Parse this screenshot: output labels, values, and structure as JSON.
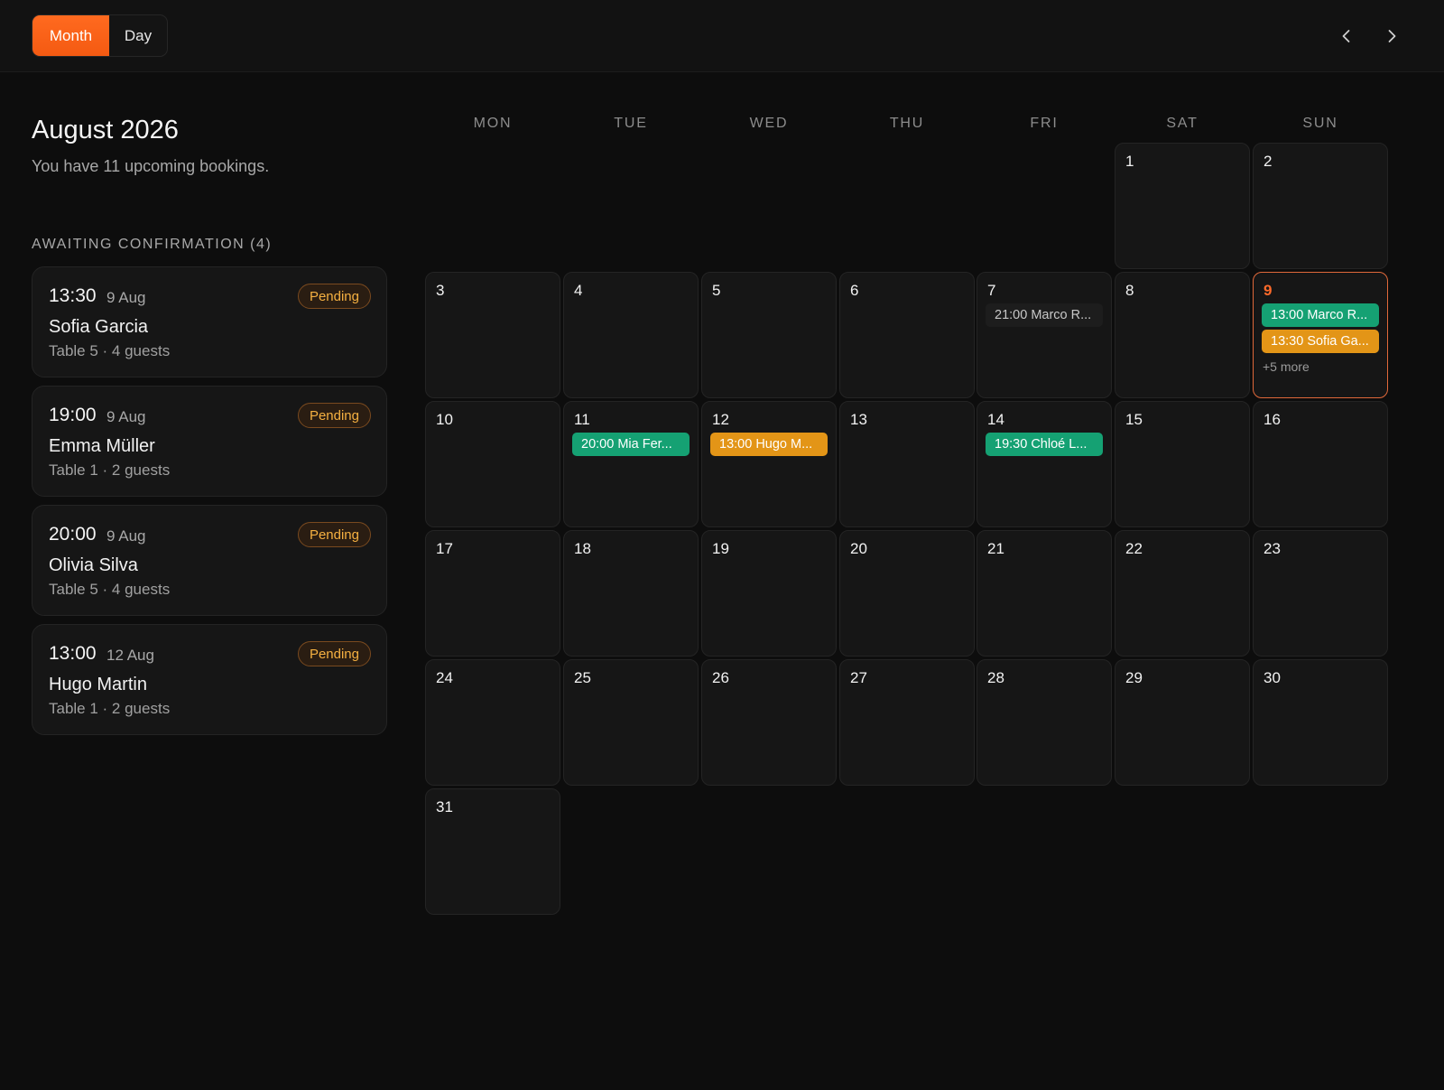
{
  "toolbar": {
    "views": [
      {
        "label": "Month",
        "active": true
      },
      {
        "label": "Day",
        "active": false
      }
    ],
    "prev_icon": "chevron-left-icon",
    "next_icon": "chevron-right-icon"
  },
  "colors": {
    "accent": "#ff6a1f",
    "confirmed": "#15a173",
    "pending": "#e39517",
    "background": "#0d0d0d",
    "card": "#161616"
  },
  "sidebar": {
    "title": "August 2026",
    "subtitle": "You have 11 upcoming bookings.",
    "section_label": "AWAITING CONFIRMATION (4)",
    "bookings": [
      {
        "time": "13:30",
        "date": "9 Aug",
        "name": "Sofia Garcia",
        "meta": "Table 5 · 4 guests",
        "status": "Pending"
      },
      {
        "time": "19:00",
        "date": "9 Aug",
        "name": "Emma Müller",
        "meta": "Table 1 · 2 guests",
        "status": "Pending"
      },
      {
        "time": "20:00",
        "date": "9 Aug",
        "name": "Olivia Silva",
        "meta": "Table 5 · 4 guests",
        "status": "Pending"
      },
      {
        "time": "13:00",
        "date": "12 Aug",
        "name": "Hugo Martin",
        "meta": "Table 1 · 2 guests",
        "status": "Pending"
      }
    ]
  },
  "calendar": {
    "weekdays": [
      "MON",
      "TUE",
      "WED",
      "THU",
      "FRI",
      "SAT",
      "SUN"
    ],
    "today": 9,
    "days": [
      {
        "day": "1",
        "events": []
      },
      {
        "day": "2",
        "events": []
      },
      {
        "day": "3",
        "events": []
      },
      {
        "day": "4",
        "events": []
      },
      {
        "day": "5",
        "events": []
      },
      {
        "day": "6",
        "events": []
      },
      {
        "day": "7",
        "events": [
          {
            "label": "21:00 Marco R...",
            "style": "grey"
          }
        ]
      },
      {
        "day": "8",
        "events": []
      },
      {
        "day": "9",
        "events": [
          {
            "label": "13:00 Marco R...",
            "style": "green"
          },
          {
            "label": "13:30 Sofia Ga...",
            "style": "orange"
          }
        ],
        "more": "+5 more"
      },
      {
        "day": "10",
        "events": []
      },
      {
        "day": "11",
        "events": [
          {
            "label": "20:00 Mia Fer...",
            "style": "green"
          }
        ]
      },
      {
        "day": "12",
        "events": [
          {
            "label": "13:00 Hugo M...",
            "style": "orange"
          }
        ]
      },
      {
        "day": "13",
        "events": []
      },
      {
        "day": "14",
        "events": [
          {
            "label": "19:30 Chloé L...",
            "style": "green"
          }
        ]
      },
      {
        "day": "15",
        "events": []
      },
      {
        "day": "16",
        "events": []
      },
      {
        "day": "17",
        "events": []
      },
      {
        "day": "18",
        "events": []
      },
      {
        "day": "19",
        "events": []
      },
      {
        "day": "20",
        "events": []
      },
      {
        "day": "21",
        "events": []
      },
      {
        "day": "22",
        "events": []
      },
      {
        "day": "23",
        "events": []
      },
      {
        "day": "24",
        "events": []
      },
      {
        "day": "25",
        "events": []
      },
      {
        "day": "26",
        "events": []
      },
      {
        "day": "27",
        "events": []
      },
      {
        "day": "28",
        "events": []
      },
      {
        "day": "29",
        "events": []
      },
      {
        "day": "30",
        "events": []
      },
      {
        "day": "31",
        "events": []
      }
    ]
  }
}
